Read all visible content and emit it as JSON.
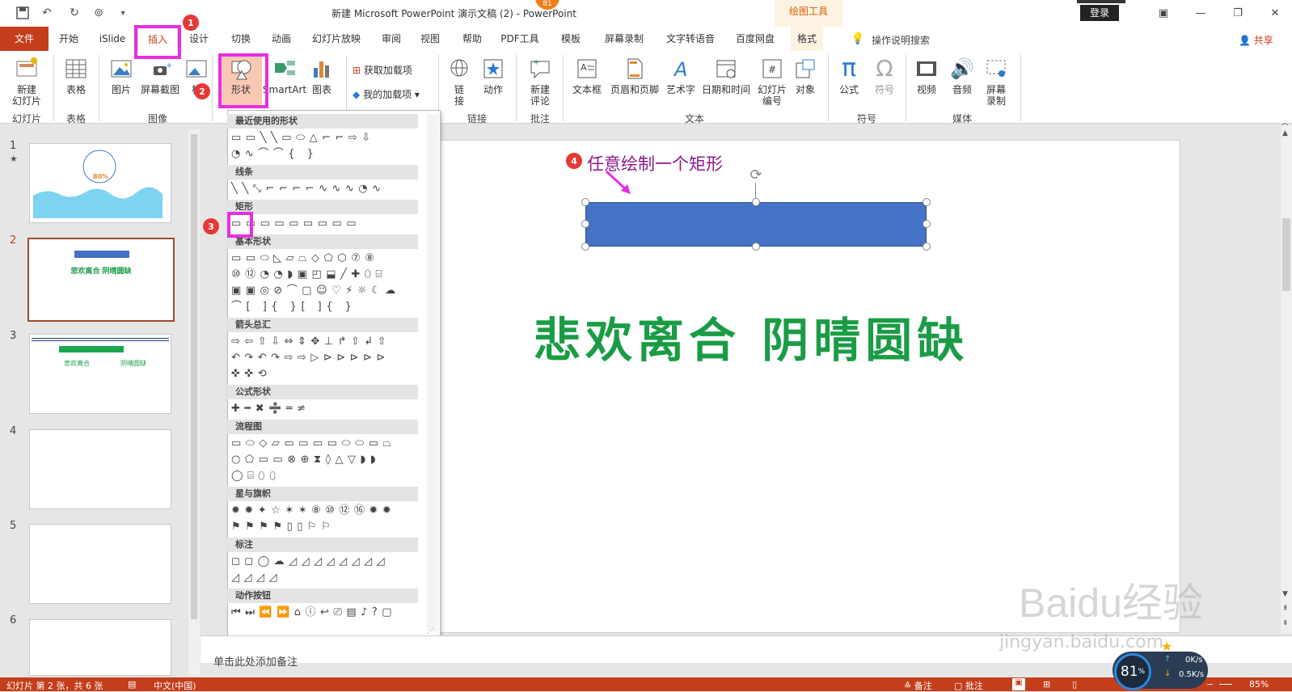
{
  "window": {
    "title": "新建 Microsoft PowerPoint 演示文稿 (2)  -  PowerPoint",
    "context_label": "绘图工具",
    "login_label": "登录",
    "badge_top": "81"
  },
  "tabs": [
    "文件",
    "开始",
    "iSlide",
    "插入",
    "设计",
    "切换",
    "动画",
    "幻灯片放映",
    "审阅",
    "视图",
    "帮助",
    "PDF工具",
    "模板",
    "屏幕录制",
    "文字转语音",
    "百度网盘",
    "格式"
  ],
  "tellme": "操作说明搜索",
  "share": "共享",
  "ribbon": {
    "new_slide": "新建\n幻灯片",
    "table": "表格",
    "picture": "图片",
    "screenshot": "屏幕截图",
    "album": "相",
    "shapes": "形状",
    "smartart": "SmartArt",
    "chart": "图表",
    "get_addins": "获取加载项",
    "my_addins": "我的加载项",
    "link": "链接",
    "action": "动作",
    "new_comment": "新建\n评论",
    "textbox": "文本框",
    "header_footer": "页眉和页脚",
    "wordart": "艺术字",
    "datetime": "日期和时间",
    "slide_number": "幻灯片\n编号",
    "object": "对象",
    "equation": "公式",
    "symbol": "符号",
    "video": "视频",
    "audio": "音频",
    "screen_record": "屏幕\n录制",
    "groups": {
      "slides": "幻灯片",
      "tables": "表格",
      "images": "图像",
      "links": "链接",
      "comments": "批注",
      "text": "文本",
      "symbols": "符号",
      "media": "媒体"
    }
  },
  "shapes_menu": {
    "sections": [
      "最近使用的形状",
      "线条",
      "矩形",
      "基本形状",
      "箭头总汇",
      "公式形状",
      "流程图",
      "星与旗帜",
      "标注",
      "动作按钮"
    ]
  },
  "slides": [
    {
      "num": "1",
      "star": "★",
      "thumb_text": "80%"
    },
    {
      "num": "2",
      "thumb_text": "悲欢离合 阴晴圆缺"
    },
    {
      "num": "3",
      "thumb_text_a": "悲欢离合",
      "thumb_text_b": "阴晴圆缺"
    },
    {
      "num": "4"
    },
    {
      "num": "5"
    },
    {
      "num": "6"
    }
  ],
  "canvas": {
    "main_text": "悲欢离合 阴晴圆缺",
    "annotation": "任意绘制一个矩形",
    "rect_color": "#4472c4",
    "text_color": "#1a9c45"
  },
  "steps": [
    "1",
    "2",
    "3",
    "4"
  ],
  "notes_placeholder": "单击此处添加备注",
  "watermark": {
    "main": "Baidu经验",
    "sub": "jingyan.baidu.com"
  },
  "status": {
    "slide_info": "幻灯片 第 2 张，共 6 张",
    "language": "中文(中国)",
    "notes": "备注",
    "comments": "批注",
    "zoom": "85%"
  },
  "netmeter": {
    "percent": "81",
    "unit": "%",
    "up": "0K/s",
    "down": "0.5K/s"
  },
  "colors": {
    "accent": "#c43e1c",
    "highlight": "#e62fe0",
    "badge": "#e53935"
  }
}
